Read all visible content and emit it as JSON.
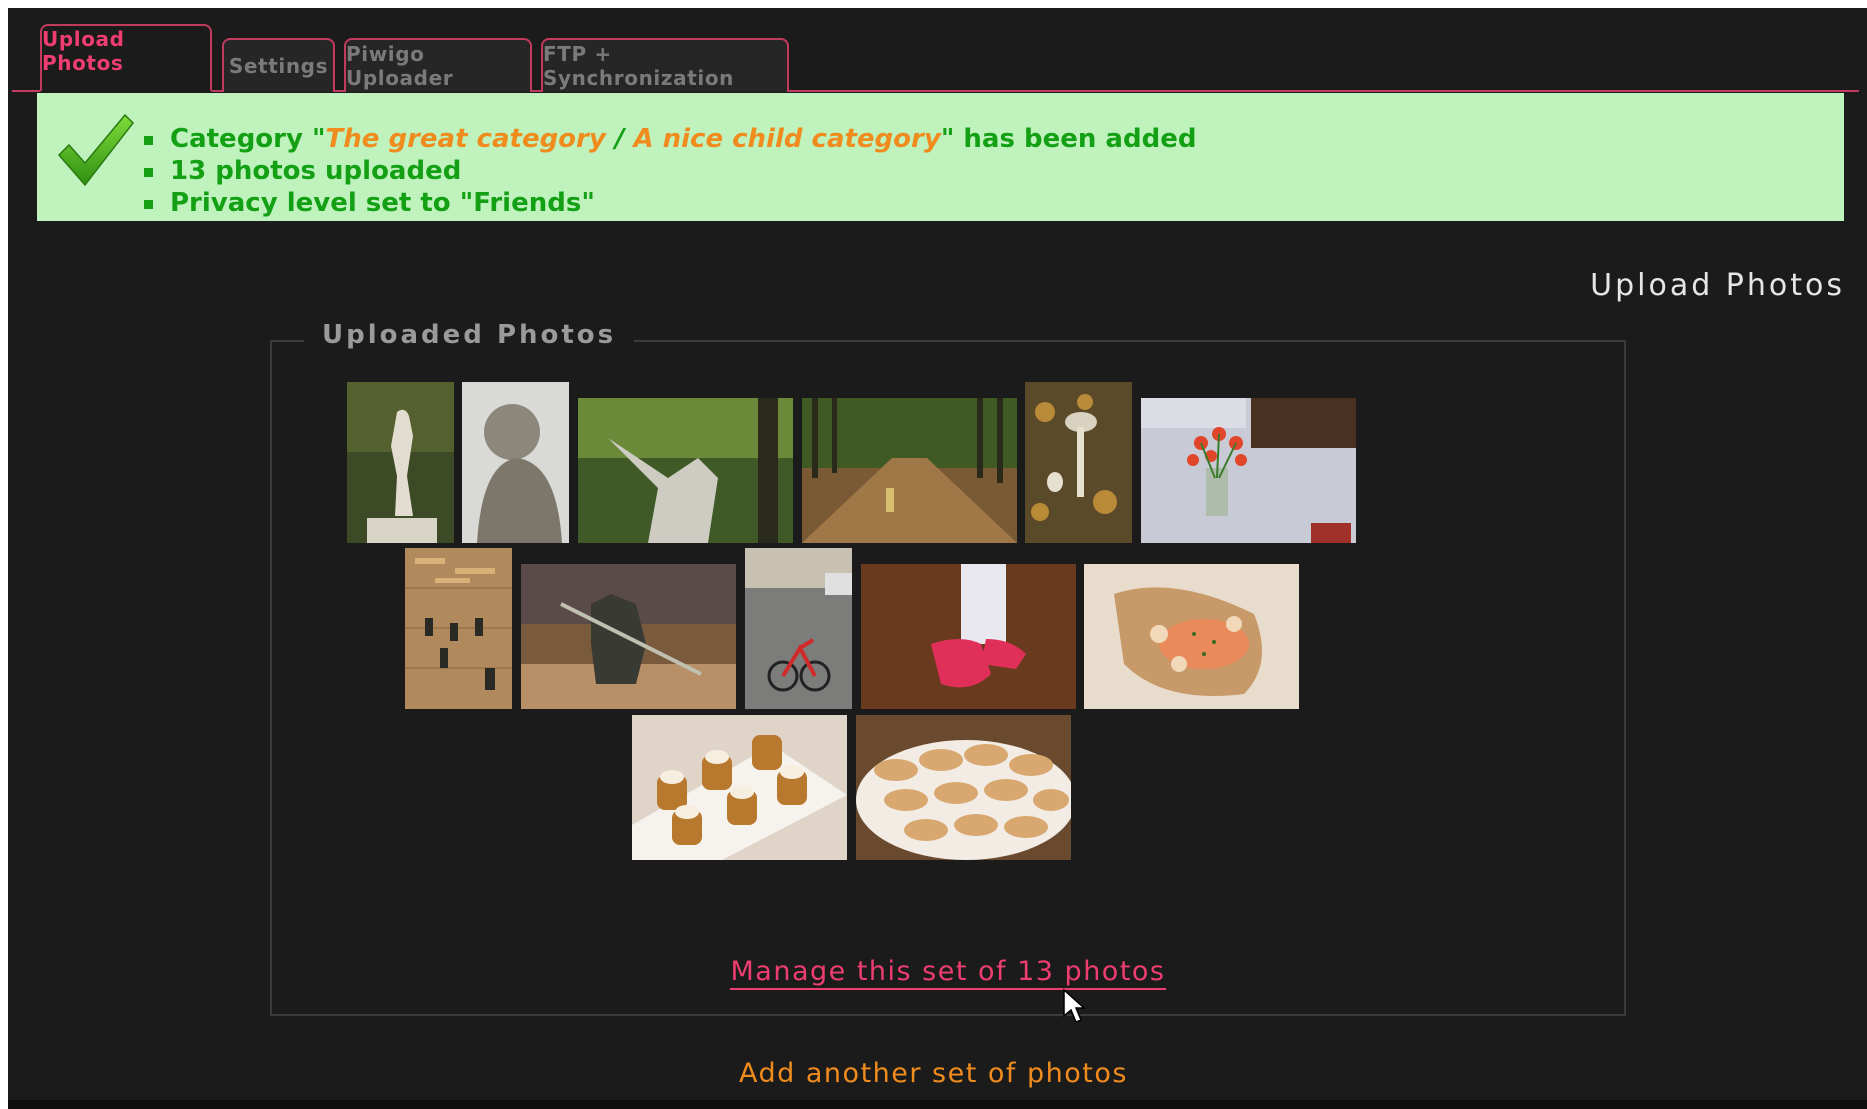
{
  "tabs": [
    {
      "label": "Upload Photos",
      "active": true
    },
    {
      "label": "Settings",
      "active": false
    },
    {
      "label": "Piwigo Uploader",
      "active": false
    },
    {
      "label": "FTP + Synchronization",
      "active": false
    }
  ],
  "notice": {
    "icon": "checkmark-icon",
    "category_prefix": "Category \"",
    "category_parent": "The great category",
    "category_separator": " / ",
    "category_child": "A nice child category",
    "category_suffix": "\" has been added",
    "photos_uploaded": "13 photos uploaded",
    "privacy": "Privacy level set to \"Friends\""
  },
  "page_title": "Upload Photos",
  "uploaded": {
    "legend": "Uploaded Photos",
    "photos": [
      {
        "name": "photo-statue-garden",
        "subject": "statue in garden"
      },
      {
        "name": "photo-cherub-statue",
        "subject": "cherub statue"
      },
      {
        "name": "photo-statue-trees",
        "subject": "statue among trees"
      },
      {
        "name": "photo-tree-alley",
        "subject": "tree alley with child"
      },
      {
        "name": "photo-mushroom",
        "subject": "mushroom in leaves"
      },
      {
        "name": "photo-tulips",
        "subject": "tulips on bed"
      },
      {
        "name": "photo-toy-soldiers",
        "subject": "toy soldiers"
      },
      {
        "name": "photo-toy-warrior",
        "subject": "toy warrior figure"
      },
      {
        "name": "photo-bicycle",
        "subject": "child on bicycle"
      },
      {
        "name": "photo-pink-shoes",
        "subject": "pink shoes"
      },
      {
        "name": "photo-salmon-dish",
        "subject": "salmon dish"
      },
      {
        "name": "photo-desserts",
        "subject": "dessert glasses"
      },
      {
        "name": "photo-macarons",
        "subject": "macarons"
      }
    ],
    "manage_link": "Manage this set of 13 photos"
  },
  "add_link": "Add another set of photos",
  "colors": {
    "accent": "#ee3d70",
    "orange": "#f08c1e",
    "success_bg": "#bff2bd",
    "success_text": "#14a014",
    "background": "#1b1b1b"
  }
}
